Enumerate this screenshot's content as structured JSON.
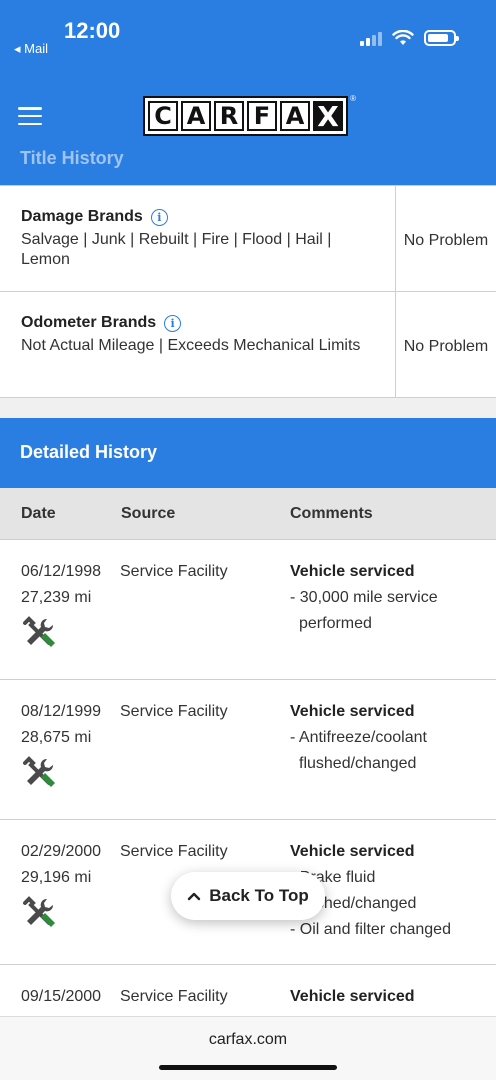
{
  "status_bar": {
    "time": "12:00",
    "back_app": "◂ Mail"
  },
  "header": {
    "logo_letters": [
      "C",
      "A",
      "R",
      "F",
      "A",
      "X"
    ],
    "logo_reg": "®",
    "partial_section_title": "Title History"
  },
  "brands": [
    {
      "title": "Damage Brands",
      "description": "Salvage | Junk | Rebuilt | Fire | Flood | Hail | Lemon",
      "status": "No Problem"
    },
    {
      "title": "Odometer Brands",
      "description": "Not Actual Mileage | Exceeds Mechanical Limits",
      "status": "No Problem"
    }
  ],
  "detailed_history": {
    "title": "Detailed History",
    "columns": {
      "date": "Date",
      "source": "Source",
      "comments": "Comments"
    },
    "rows": [
      {
        "date": "06/12/1998",
        "mileage": "27,239 mi",
        "source": "Service Facility",
        "comment_title": "Vehicle serviced",
        "items": [
          "- 30,000 mile service performed"
        ]
      },
      {
        "date": "08/12/1999",
        "mileage": "28,675 mi",
        "source": "Service Facility",
        "comment_title": "Vehicle serviced",
        "items": [
          "- Antifreeze/coolant flushed/changed"
        ]
      },
      {
        "date": "02/29/2000",
        "mileage": "29,196 mi",
        "source": "Service Facility",
        "comment_title": "Vehicle serviced",
        "items": [
          "- Brake fluid flushed/changed",
          "- Oil and filter changed"
        ]
      },
      {
        "date": "09/15/2000",
        "mileage": "",
        "source": "Service Facility",
        "comment_title": "Vehicle serviced",
        "items": []
      }
    ]
  },
  "back_to_top": "Back To Top",
  "browser": {
    "url": "carfax.com"
  },
  "colors": {
    "brand_blue": "#2a7de1",
    "tool_green": "#2e8b3a"
  }
}
